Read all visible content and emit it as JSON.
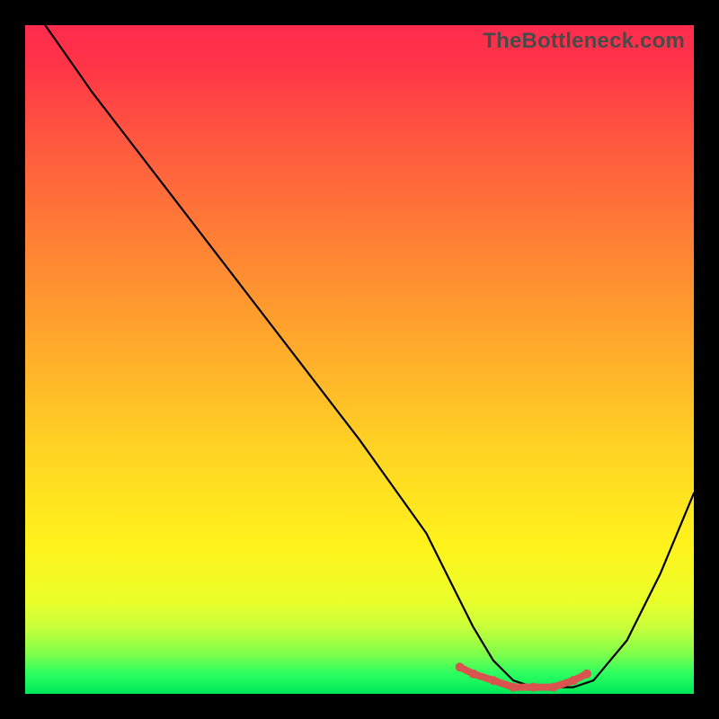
{
  "watermark": "TheBottleneck.com",
  "chart_data": {
    "type": "line",
    "title": "",
    "xlabel": "",
    "ylabel": "",
    "xlim": [
      0,
      100
    ],
    "ylim": [
      0,
      100
    ],
    "series": [
      {
        "name": "curve",
        "x": [
          3,
          10,
          20,
          30,
          40,
          50,
          60,
          63,
          67,
          70,
          73,
          76,
          79,
          82,
          85,
          90,
          95,
          100
        ],
        "values": [
          100,
          90,
          77,
          64,
          51,
          38,
          24,
          18,
          10,
          5,
          2,
          1,
          1,
          1,
          2,
          8,
          18,
          30
        ]
      },
      {
        "name": "highlight",
        "x": [
          65,
          67,
          70,
          73,
          76,
          79,
          82,
          84
        ],
        "values": [
          4,
          3,
          2,
          1,
          1,
          1,
          2,
          3
        ]
      }
    ],
    "colors": {
      "curve": "#000000",
      "highlight": "#d9534f"
    }
  }
}
